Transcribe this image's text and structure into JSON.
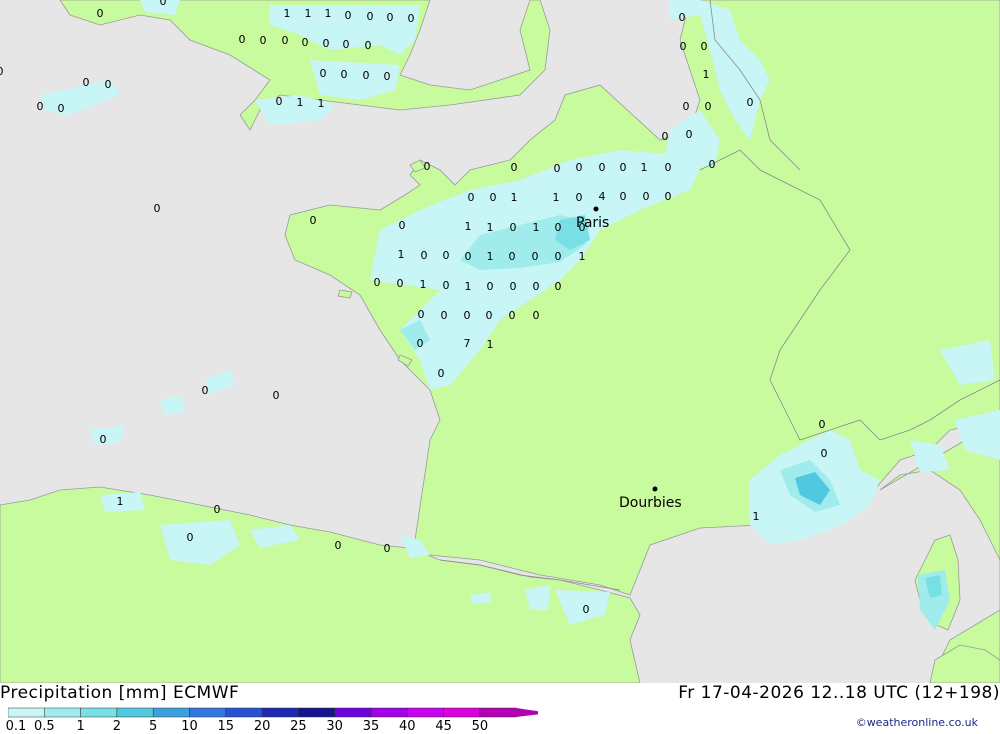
{
  "map": {
    "cities": [
      {
        "name": "Paris"
      },
      {
        "name": "Dourbies"
      }
    ],
    "precip_labels": [
      "1",
      "1",
      "1",
      "0",
      "0",
      "0",
      "0",
      "0",
      "0",
      "0",
      "0",
      "0",
      "0",
      "0",
      "0",
      "0",
      "0",
      "0",
      "0",
      "0",
      "1",
      "1",
      "0",
      "0",
      "0",
      "0",
      "0",
      "0",
      "0",
      "0",
      "0",
      "0",
      "1",
      "0",
      "0",
      "0",
      "0",
      "0",
      "0",
      "0",
      "0",
      "0",
      "0",
      "0",
      "1",
      "0",
      "0",
      "0",
      "0",
      "1",
      "1",
      "0",
      "4",
      "0",
      "0",
      "0",
      "0",
      "0",
      "1",
      "1",
      "0",
      "1",
      "0",
      "0",
      "1",
      "0",
      "0",
      "0",
      "1",
      "0",
      "0",
      "0",
      "1",
      "0",
      "0",
      "1",
      "0",
      "1",
      "0",
      "0",
      "0",
      "0",
      "0",
      "0",
      "0",
      "0",
      "0",
      "0",
      "0",
      "7",
      "1",
      "0",
      "0",
      "0",
      "0",
      "1",
      "0",
      "0",
      "0",
      "0",
      "0",
      "0",
      "0",
      "1"
    ]
  },
  "footer": {
    "title": "Precipitation [mm] ECMWF",
    "datetime": "Fr 17-04-2026 12..18 UTC (12+198)",
    "credit": "©weatheronline.co.uk",
    "scale_ticks": [
      "0.1",
      "0.5",
      "1",
      "2",
      "5",
      "10",
      "15",
      "20",
      "25",
      "30",
      "35",
      "40",
      "45",
      "50"
    ],
    "scale_colors": [
      "#c8f5f5",
      "#a0ecec",
      "#78e0e4",
      "#50c8e0",
      "#3ca0dc",
      "#3278dc",
      "#2850d2",
      "#1e28b4",
      "#14148c",
      "#6e00dc",
      "#a000e6",
      "#c800f0",
      "#dc00dc",
      "#b400b4"
    ]
  }
}
